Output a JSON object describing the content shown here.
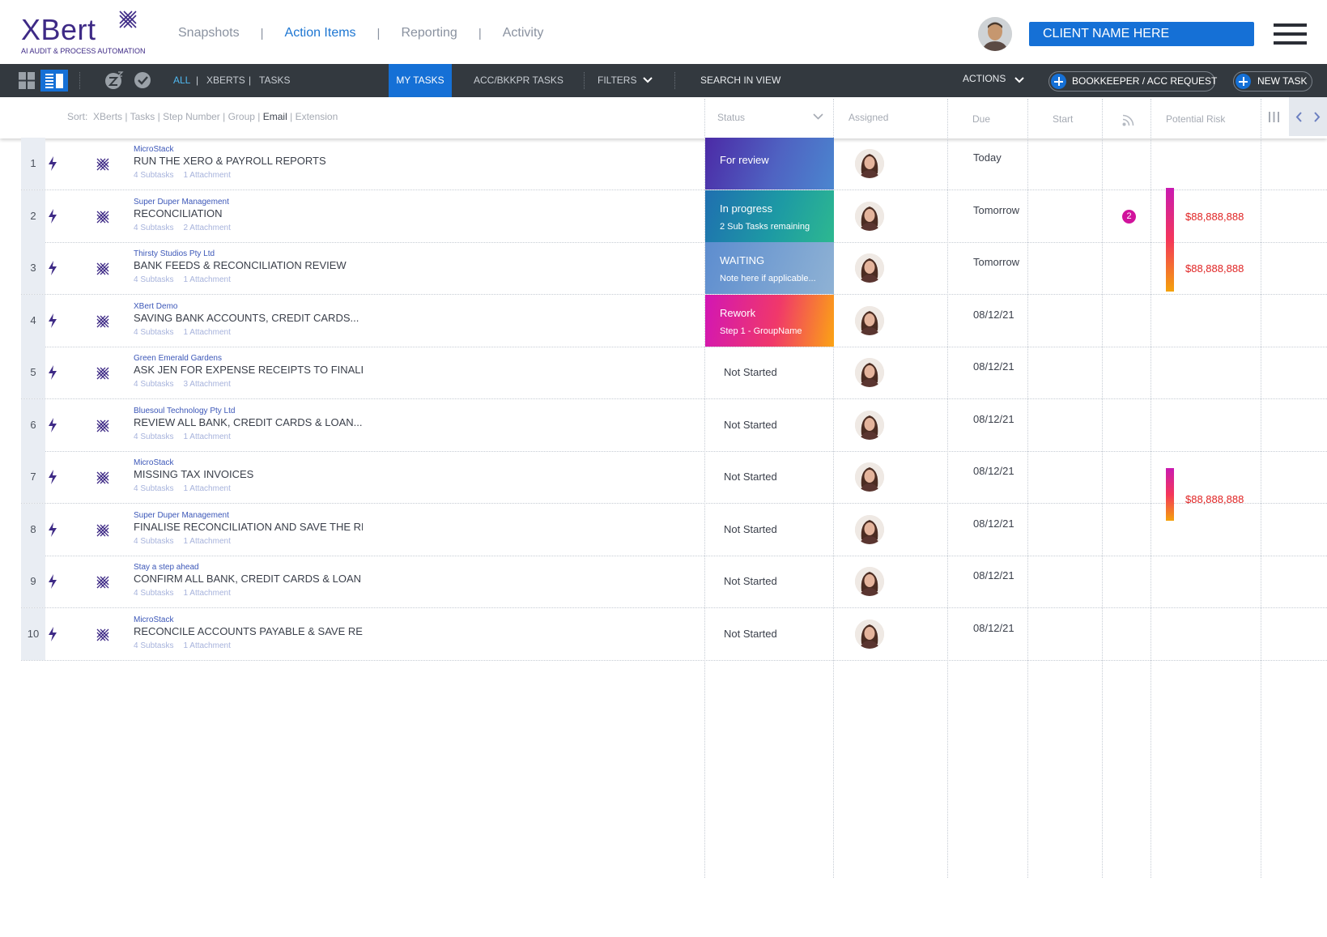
{
  "brand": {
    "name": "XBert",
    "tagline": "AI AUDIT & PROCESS AUTOMATION",
    "color": "#3e2a86"
  },
  "topnav": {
    "items": [
      "Snapshots",
      "Action Items",
      "Reporting",
      "Activity"
    ],
    "separator": "|",
    "active": "Action Items"
  },
  "header": {
    "client_button": "CLIENT NAME HERE",
    "menu_icon": "hamburger-icon"
  },
  "toolbar": {
    "view_icons": [
      "grid-view-icon",
      "list-view-icon"
    ],
    "filter_icons": [
      "snooze-icon",
      "check-circle-icon"
    ],
    "scope": [
      "ALL",
      "XBERTS",
      "TASKS"
    ],
    "scope_sep": "|",
    "tabs": [
      "MY TASKS",
      "ACC/BKKPR TASKS"
    ],
    "filters_label": "FILTERS",
    "search_label": "SEARCH IN VIEW",
    "actions_label": "ACTIONS",
    "bookkeeper_button": "BOOKKEEPER / ACC REQUEST",
    "new_task_button": "NEW TASK"
  },
  "sort": {
    "label": "Sort:",
    "options": [
      "XBerts",
      "Tasks",
      "Step Number",
      "Group",
      "Email",
      "Extension"
    ],
    "selected": "Email"
  },
  "columns": {
    "status": "Status",
    "assigned": "Assigned",
    "due": "Due",
    "start": "Start",
    "feed_icon": "rss-icon",
    "risk": "Potential Risk",
    "column_picker_icon": "columns-icon"
  },
  "colors": {
    "accent": "#1570d6",
    "toolbar": "#33393f",
    "risk": "#e02424",
    "badge": "#d1139c"
  },
  "tasks": [
    {
      "num": "1",
      "client": "MicroStack",
      "title": "RUN THE XERO & PAYROLL REPORTS",
      "subtasks": "4 Subtasks",
      "attachments": "1 Attachment",
      "status": "For review",
      "status_note": "",
      "due": "Today",
      "badge": "",
      "risk": ""
    },
    {
      "num": "2",
      "client": "Super Duper Management",
      "title": "RECONCILIATION",
      "subtasks": "4 Subtasks",
      "attachments": "2 Attachment",
      "status": "In progress",
      "status_note": "2 Sub Tasks remaining",
      "due": "Tomorrow",
      "badge": "2",
      "risk": "$88,888,888"
    },
    {
      "num": "3",
      "client": "Thirsty Studios Pty Ltd",
      "title": "BANK FEEDS & RECONCILIATION REVIEW",
      "subtasks": "4 Subtasks",
      "attachments": "1 Attachment",
      "status": "WAITING",
      "status_note": "Note here if applicable...",
      "due": "Tomorrow",
      "badge": "",
      "risk": "$88,888,888"
    },
    {
      "num": "4",
      "client": "XBert Demo",
      "title": "SAVING BANK ACCOUNTS, CREDIT CARDS...",
      "subtasks": "4 Subtasks",
      "attachments": "1 Attachment",
      "status": "Rework",
      "status_note": "Step 1 - GroupName",
      "due": "08/12/21",
      "badge": "",
      "risk": ""
    },
    {
      "num": "5",
      "client": "Green Emerald Gardens",
      "title": "ASK JEN FOR EXPENSE RECEIPTS TO FINALISE BAS",
      "subtasks": "4 Subtasks",
      "attachments": "3 Attachment",
      "status": "Not Started",
      "status_note": "",
      "due": "08/12/21",
      "badge": "",
      "risk": ""
    },
    {
      "num": "6",
      "client": "Bluesoul Technology Pty Ltd",
      "title": "REVIEW ALL BANK, CREDIT CARDS & LOAN...",
      "subtasks": "4 Subtasks",
      "attachments": "1 Attachment",
      "status": "Not Started",
      "status_note": "",
      "due": "08/12/21",
      "badge": "",
      "risk": ""
    },
    {
      "num": "7",
      "client": "MicroStack",
      "title": "MISSING TAX INVOICES",
      "subtasks": "4 Subtasks",
      "attachments": "1 Attachment",
      "status": "Not Started",
      "status_note": "",
      "due": "08/12/21",
      "badge": "",
      "risk": "$88,888,888"
    },
    {
      "num": "8",
      "client": "Super Duper Management",
      "title": "FINALISE RECONCILIATION AND SAVE THE REP",
      "subtasks": "4 Subtasks",
      "attachments": "1 Attachment",
      "status": "Not Started",
      "status_note": "",
      "due": "08/12/21",
      "badge": "",
      "risk": ""
    },
    {
      "num": "9",
      "client": "Stay a step ahead",
      "title": "CONFIRM ALL BANK, CREDIT CARDS & LOAN AC",
      "subtasks": "4 Subtasks",
      "attachments": "1 Attachment",
      "status": "Not Started",
      "status_note": "",
      "due": "08/12/21",
      "badge": "",
      "risk": ""
    },
    {
      "num": "10",
      "client": "MicroStack",
      "title": "RECONCILE ACCOUNTS PAYABLE & SAVE REPO",
      "subtasks": "4 Subtasks",
      "attachments": "1 Attachment",
      "status": "Not Started",
      "status_note": "",
      "due": "08/12/21",
      "badge": "",
      "risk": ""
    }
  ]
}
